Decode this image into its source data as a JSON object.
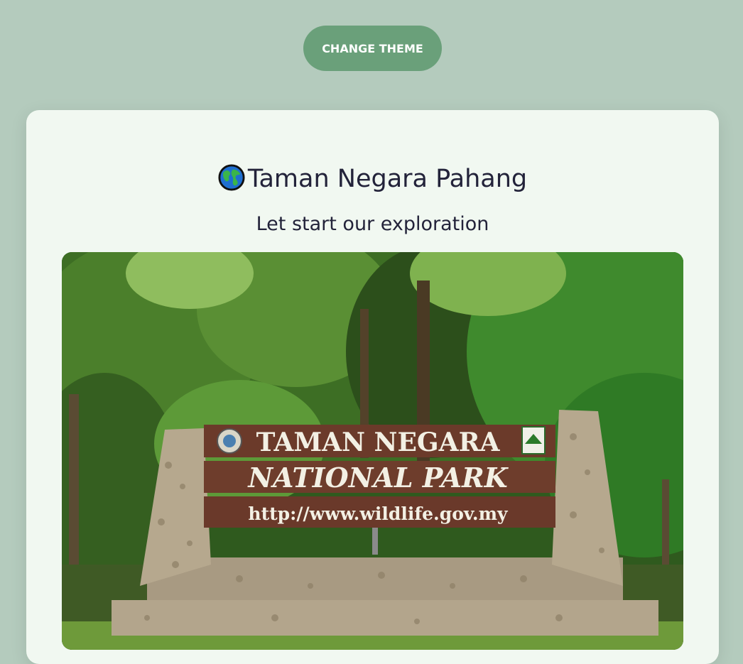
{
  "header": {
    "theme_button_label": "CHANGE THEME"
  },
  "card": {
    "title_icon": "globe-icon",
    "title": "Taman Negara Pahang",
    "subtitle": "Let start our exploration",
    "photo": {
      "sign_line_1": "TAMAN NEGARA",
      "sign_line_2": "NATIONAL PARK",
      "sign_line_3": "http://www.wildlife.gov.my"
    }
  },
  "colors": {
    "page_background": "#b4cbbd",
    "button_background": "#6aa07a",
    "card_background": "#f1f8f1",
    "text": "#23233a"
  }
}
